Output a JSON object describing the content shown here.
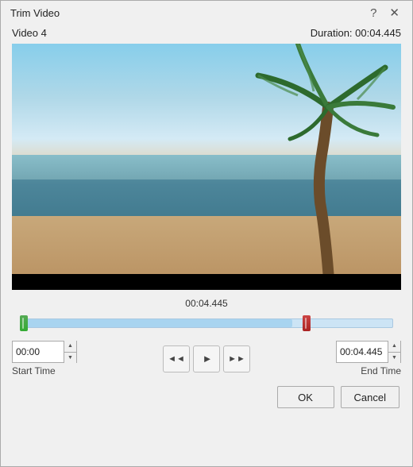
{
  "dialog": {
    "title": "Trim Video",
    "help_label": "?",
    "close_label": "✕"
  },
  "video": {
    "name": "Video 4",
    "duration_label": "Duration: 00:04.445",
    "timecode": "00:04.445"
  },
  "timeline": {
    "fill_pct": 73
  },
  "controls": {
    "start_time_value": "00:00",
    "end_time_value": "00:04.445",
    "start_time_label": "Start Time",
    "end_time_label": "End Time",
    "btn_rewind": "◄◄",
    "btn_play": "►",
    "btn_forward": "►►"
  },
  "actions": {
    "ok_label": "OK",
    "cancel_label": "Cancel"
  }
}
